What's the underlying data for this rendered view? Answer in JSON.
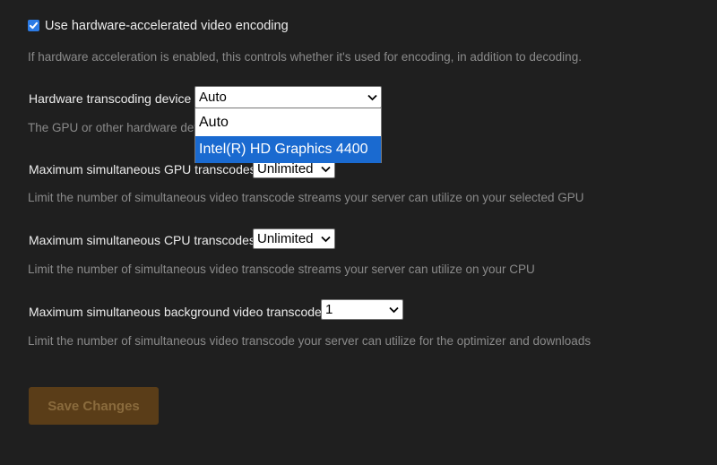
{
  "hw_encoding": {
    "checkbox_label": "Use hardware-accelerated video encoding",
    "checked": true,
    "description": "If hardware acceleration is enabled, this controls whether it's used for encoding, in addition to decoding."
  },
  "transcoding_device": {
    "label": "Hardware transcoding device",
    "selected": "Auto",
    "description_visible": "The GPU or other hardware dev",
    "options": [
      "Auto",
      "Intel(R) HD Graphics 4400"
    ],
    "highlighted_option": "Intel(R) HD Graphics 4400"
  },
  "gpu_transcodes": {
    "label": "Maximum simultaneous GPU transcodes",
    "selected": "Unlimited",
    "description": "Limit the number of simultaneous video transcode streams your server can utilize on your selected GPU"
  },
  "cpu_transcodes": {
    "label": "Maximum simultaneous CPU transcodes",
    "selected": "Unlimited",
    "description": "Limit the number of simultaneous video transcode streams your server can utilize on your CPU"
  },
  "background_transcode": {
    "label": "Maximum simultaneous background video transcode",
    "selected": "1",
    "description": "Limit the number of simultaneous video transcode your server can utilize for the optimizer and downloads"
  },
  "save_button": {
    "label": "Save Changes",
    "enabled": false
  },
  "colors": {
    "background": "#1f1f1f",
    "checkbox_accent": "#2c7be5",
    "option_highlight": "#1a6ad0",
    "save_button_bg": "#5a3d18"
  }
}
